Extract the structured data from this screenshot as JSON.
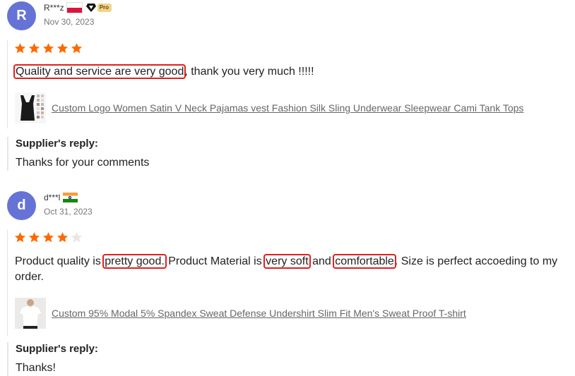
{
  "reviews": [
    {
      "avatar_letter": "R",
      "username": "R***z",
      "flag": "poland-flag",
      "badge": "Pro",
      "date": "Nov 30, 2023",
      "rating": 5,
      "comment": {
        "hl1": "Quality and service are very good",
        "rest": ", thank you very much !!!!!"
      },
      "product": "Custom Logo Women Satin V Neck Pajamas vest Fashion Silk Sling Underwear Sleepwear Cami Tank Tops",
      "reply_title": "Supplier's reply:",
      "reply_text": "Thanks for your comments"
    },
    {
      "avatar_letter": "d",
      "username": "d***l",
      "flag": "india-flag",
      "date": "Oct 31, 2023",
      "rating": 4,
      "comment": {
        "t1": "Product quality is ",
        "hl1": "pretty good.",
        "t2": " Product Material is ",
        "hl2": "very soft",
        "t3": " and ",
        "hl3": "comfortable",
        "t4": ". Size is perfect accoeding to my order."
      },
      "product": "Custom 95% Modal 5% Spandex Sweat Defense Undershirt Slim Fit Men's Sweat Proof T-shirt",
      "reply_title": "Supplier's reply:",
      "reply_text": "Thanks!"
    }
  ],
  "colors": {
    "star": "#ff6a00",
    "star_empty": "#e6e6e6",
    "highlight": "#e0201f",
    "avatar": "#6573d6"
  }
}
